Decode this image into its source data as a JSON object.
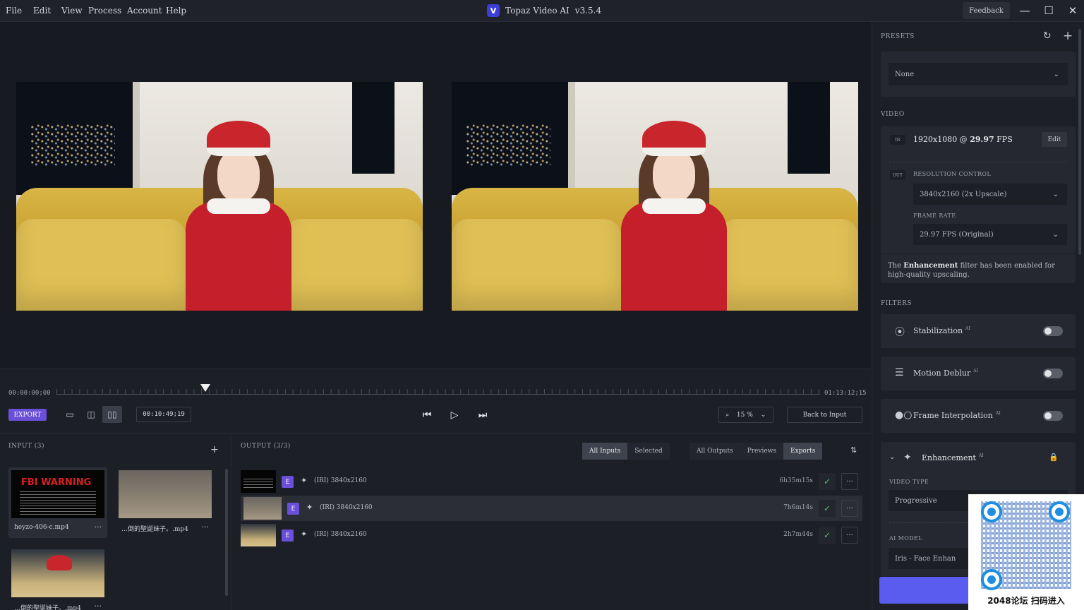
{
  "menu": [
    "File",
    "Edit",
    "View",
    "Process",
    "Account",
    "Help"
  ],
  "app": {
    "logo": "V",
    "title": "Topaz Video AI",
    "version": "v3.5.4"
  },
  "titlebar": {
    "feedback": "Feedback",
    "minimize": "—",
    "maximize": "☐",
    "close": "✕"
  },
  "timeline": {
    "start": "00:00:00;00",
    "end": "01:13:12;15",
    "current": "00:10:49;19",
    "playhead_fraction": 0.195,
    "export_label": "EXPORT",
    "zoom": "15 %",
    "back_to_input": "Back to Input"
  },
  "input": {
    "title": "INPUT (3)",
    "add": "+",
    "items": [
      {
        "label": "heyzo-406-c.mp4",
        "fbi_title": "FBI WARNING"
      },
      {
        "label": "…倒的聖誕妹子。.mp4"
      },
      {
        "label": "…倒的聖誕妹子。.mp4"
      }
    ],
    "more": "···"
  },
  "output": {
    "title": "OUTPUT (3/3)",
    "filters_a": [
      "All Inputs",
      "Selected"
    ],
    "filters_b": [
      "All Outputs",
      "Previews",
      "Exports"
    ],
    "sort": "⇅",
    "rows": [
      {
        "badge": "E",
        "desc": "(IRI) 3840x2160",
        "duration": "6h35m15s"
      },
      {
        "badge": "E",
        "desc": "(IRI) 3840x2160",
        "duration": "7h6m14s"
      },
      {
        "badge": "E",
        "desc": "(IRI) 3840x2160",
        "duration": "2h7m44s"
      }
    ],
    "check": "✓",
    "more": "···"
  },
  "presets": {
    "title": "PRESETS",
    "value": "None"
  },
  "video": {
    "title": "VIDEO",
    "in_tag": "IN",
    "out_tag": "OUT",
    "input_res": "1920x1080",
    "at": "@",
    "input_fps": "29.97",
    "fps_unit": "FPS",
    "edit": "Edit",
    "resolution_label": "RESOLUTION CONTROL",
    "resolution_value": "3840x2160 (2x Upscale)",
    "framerate_label": "FRAME RATE",
    "framerate_value": "29.97 FPS (Original)",
    "note_pre": "The",
    "note_bold": "Enhancement",
    "note_post": "filter has been enabled for high-quality upscaling."
  },
  "filters": {
    "title": "FILTERS",
    "ai": "AI",
    "items": [
      "Stabilization",
      "Motion Deblur",
      "Frame Interpolation"
    ],
    "enhancement": {
      "name": "Enhancement",
      "video_type_label": "VIDEO TYPE",
      "video_type_value": "Progressive",
      "ai_model_label": "AI MODEL",
      "ai_model_value": "Iris - Face Enhan"
    }
  },
  "export_button": "Ex",
  "qr_caption": "2048论坛 扫码进入"
}
